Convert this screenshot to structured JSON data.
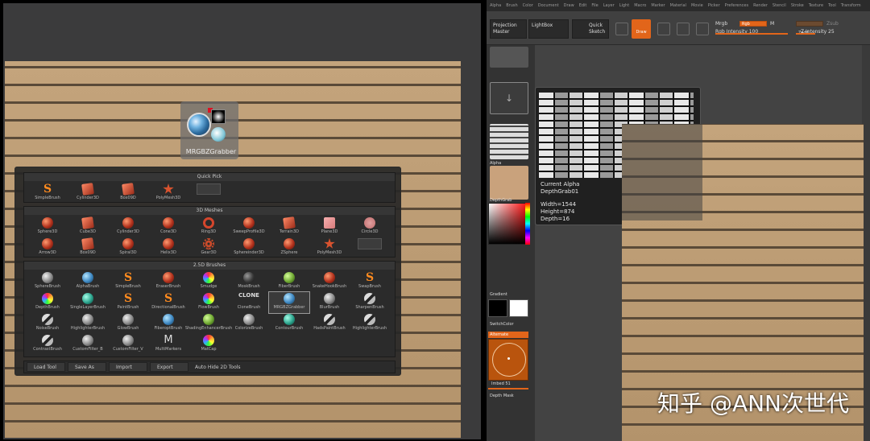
{
  "left": {
    "brush_tile": {
      "name": "MRGBZGrabber"
    },
    "quick_pick": {
      "title": "Quick Pick",
      "items": [
        {
          "label": "SimpleBrush",
          "icon": "s"
        },
        {
          "label": "Cylinder3D",
          "icon": "cube"
        },
        {
          "label": "Box09D",
          "icon": "cube"
        },
        {
          "label": "PolyMesh3D",
          "icon": "star"
        },
        {
          "label": "",
          "icon": "blank"
        }
      ]
    },
    "meshes_3d": {
      "title": "3D Meshes",
      "items": [
        {
          "label": "Sphere3D",
          "icon": "sphere"
        },
        {
          "label": "Cube3D",
          "icon": "cube"
        },
        {
          "label": "Cylinder3D",
          "icon": "sphere"
        },
        {
          "label": "Cone3D",
          "icon": "sphere"
        },
        {
          "label": "Ring3D",
          "icon": "ring"
        },
        {
          "label": "SweepProfile3D",
          "icon": "sphere"
        },
        {
          "label": "Terrain3D",
          "icon": "cube"
        },
        {
          "label": "Plane3D",
          "icon": "pink"
        },
        {
          "label": "Circle3D",
          "icon": "disc"
        },
        {
          "label": "Arrow3D",
          "icon": "sphere"
        },
        {
          "label": "Box09D",
          "icon": "cube"
        },
        {
          "label": "Spiral3D",
          "icon": "sphere"
        },
        {
          "label": "Helix3D",
          "icon": "sphere"
        },
        {
          "label": "Gear3D",
          "icon": "gear"
        },
        {
          "label": "Sphereinder3D",
          "icon": "sphere"
        },
        {
          "label": "ZSphere",
          "icon": "sphere"
        },
        {
          "label": "PolyMesh3D",
          "icon": "star"
        },
        {
          "label": "",
          "icon": "blank"
        }
      ]
    },
    "brushes_25d": {
      "title": "2.5D Brushes",
      "items": [
        {
          "label": "SphereBrush",
          "icon": "grey"
        },
        {
          "label": "AlphaBrush",
          "icon": "blue"
        },
        {
          "label": "SimpleBrush",
          "icon": "s"
        },
        {
          "label": "EraserBrush",
          "icon": "sphere"
        },
        {
          "label": "Smudge",
          "icon": "rainbow"
        },
        {
          "label": "MoskBrush",
          "icon": "dark"
        },
        {
          "label": "FiberBrush",
          "icon": "green"
        },
        {
          "label": "SnakeHookBrush",
          "icon": "sphere"
        },
        {
          "label": "SwapBrush",
          "icon": "s"
        },
        {
          "label": "DepthBrush",
          "icon": "rainbow"
        },
        {
          "label": "SingleLayerBrush",
          "icon": "teal"
        },
        {
          "label": "PaintBrush",
          "icon": "s"
        },
        {
          "label": "DirectionalBrush",
          "icon": "s"
        },
        {
          "label": "FlowBrush",
          "icon": "rainbow"
        },
        {
          "label": "CloneBrush",
          "icon": "clone"
        },
        {
          "label": "MRGBZGrabber",
          "icon": "blue",
          "selected": true
        },
        {
          "label": "BlurBrush",
          "icon": "grey"
        },
        {
          "label": "SharpenBrush",
          "icon": "slash"
        },
        {
          "label": "NoiseBrush",
          "icon": "slash"
        },
        {
          "label": "HighlighterBrush",
          "icon": "grey"
        },
        {
          "label": "GlowBrush",
          "icon": "grey"
        },
        {
          "label": "FiberoptBrush",
          "icon": "blue"
        },
        {
          "label": "ShadingEnhancerBrush",
          "icon": "green"
        },
        {
          "label": "ColorizeBrush",
          "icon": "grey"
        },
        {
          "label": "ContourBrush",
          "icon": "teal"
        },
        {
          "label": "HadsPaintBrush",
          "icon": "slash"
        },
        {
          "label": "HighlighterBrush",
          "icon": "slash"
        },
        {
          "label": "ContrastBrush",
          "icon": "slash"
        },
        {
          "label": "CustomFilter_B",
          "icon": "grey"
        },
        {
          "label": "CustomFilter_V",
          "icon": "grey"
        },
        {
          "label": "MultiMarkers",
          "icon": "mtext"
        },
        {
          "label": "MatCap",
          "icon": "rainbow"
        }
      ]
    },
    "clone_label": "CLONE",
    "bottom_bar": {
      "load_tool": "Load Tool",
      "save_as": "Save As",
      "import": "Import",
      "export": "Export",
      "auto_hide": "Auto Hide 2D Tools"
    }
  },
  "right": {
    "menubar": [
      "Alpha",
      "Brush",
      "Color",
      "Document",
      "Draw",
      "Edit",
      "File",
      "Layer",
      "Light",
      "Macro",
      "Marker",
      "Material",
      "Movie",
      "Picker",
      "Preferences",
      "Render",
      "Stencil",
      "Stroke",
      "Texture",
      "Tool",
      "Transform"
    ],
    "toolbar": {
      "projection_master": "Projection Master",
      "lightbox": "LightBox",
      "quick_sketch": "Quick Sketch",
      "draw": "Draw",
      "mrgb": "Mrgb",
      "rgb": "Rgb",
      "m": "M",
      "zadd": "Zadd",
      "zsub": "Zsub",
      "rgb_intensity": "Rgb Intensity 100",
      "z_intensity": "Z Intensity 25"
    },
    "shelf": {
      "alpha_label": "Alpha",
      "texture_label": "DepthGrab",
      "gradient": "Gradient",
      "switch_color": "SwitchColor",
      "alternate": "Alternate",
      "imbed": "Imbed 51",
      "depth_mask": "Depth Mask"
    },
    "tooltip": {
      "title": "Current Alpha",
      "name": "DepthGrab01",
      "width": "Width=1544",
      "height": "Height=874",
      "depth": "Depth=16"
    }
  },
  "watermark": "知乎 @ANN次世代"
}
